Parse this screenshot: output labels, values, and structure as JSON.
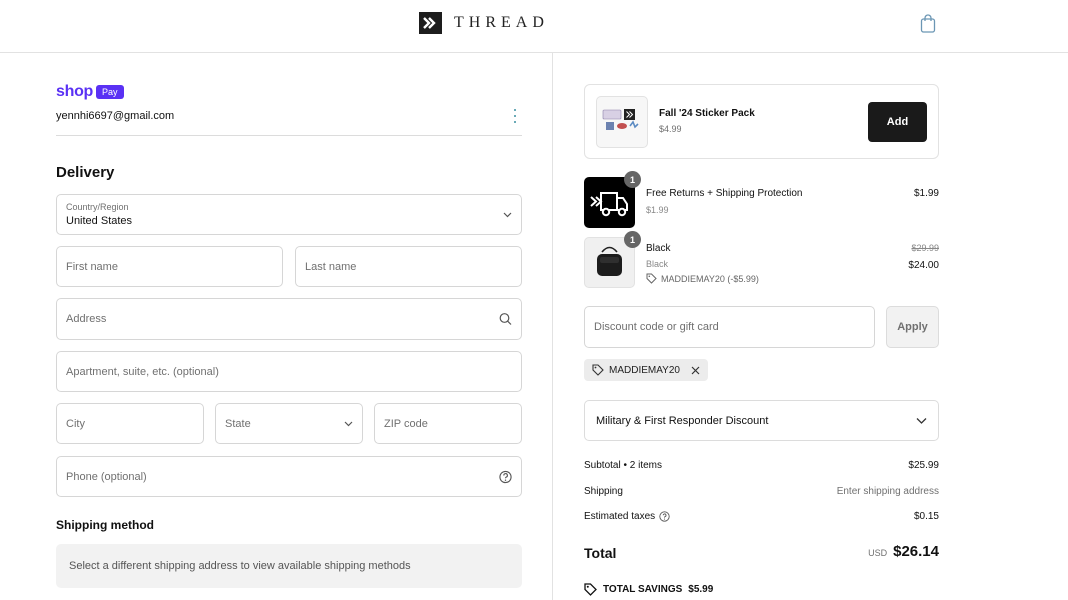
{
  "header": {
    "brand": "THREAD",
    "logo_icon": "chevrons-right-icon",
    "cart_icon": "shopping-bag-icon"
  },
  "account": {
    "shop_word": "shop",
    "pay_word": "Pay",
    "email": "yennhi6697@gmail.com",
    "menu_icon": "kebab-menu-icon"
  },
  "delivery": {
    "title": "Delivery",
    "country_label": "Country/Region",
    "country_value": "United States",
    "first_name_placeholder": "First name",
    "last_name_placeholder": "Last name",
    "address_placeholder": "Address",
    "apartment_placeholder": "Apartment, suite, etc. (optional)",
    "city_placeholder": "City",
    "state_placeholder": "State",
    "zip_placeholder": "ZIP code",
    "phone_placeholder": "Phone (optional)"
  },
  "shipping_method": {
    "title": "Shipping method",
    "message": "Select a different shipping address to view available shipping methods"
  },
  "upsell": {
    "name": "Fall '24 Sticker Pack",
    "price": "$4.99",
    "button_label": "Add"
  },
  "items": [
    {
      "name": "Free Returns + Shipping Protection",
      "sub": "$1.99",
      "price": "$1.99",
      "quantity": "1",
      "icon": "delivery-truck-icon"
    },
    {
      "name": "Black",
      "sub": "Black",
      "original_price": "$29.99",
      "price": "$24.00",
      "discount": "MADDIEMAY20 (-$5.99)",
      "quantity": "1",
      "icon": "crossbody-bag-icon"
    }
  ],
  "discount": {
    "placeholder": "Discount code or gift card",
    "apply_label": "Apply",
    "applied_code": "MADDIEMAY20"
  },
  "military": {
    "label": "Military & First Responder Discount"
  },
  "summary": {
    "subtotal_label": "Subtotal • 2 items",
    "subtotal_value": "$25.99",
    "shipping_label": "Shipping",
    "shipping_value": "Enter shipping address",
    "taxes_label": "Estimated taxes",
    "taxes_value": "$0.15",
    "total_label": "Total",
    "currency": "USD",
    "total_value": "$26.14",
    "savings_label": "TOTAL SAVINGS",
    "savings_value": "$5.99"
  },
  "colors": {
    "shop_pay_purple": "#5a31f4",
    "button_dark": "#1a1a1a",
    "border": "#d6d6d6",
    "muted_text": "#707070"
  }
}
